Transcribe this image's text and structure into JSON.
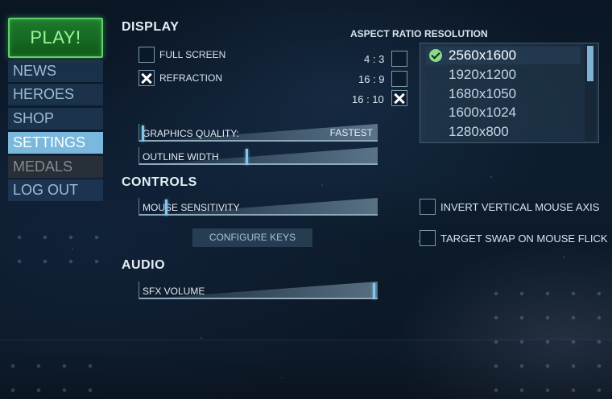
{
  "menu": {
    "play": "PLAY!",
    "items": [
      {
        "label": "NEWS"
      },
      {
        "label": "HEROES"
      },
      {
        "label": "SHOP"
      },
      {
        "label": "SETTINGS"
      },
      {
        "label": "MEDALS"
      },
      {
        "label": "LOG OUT"
      }
    ],
    "active": "SETTINGS"
  },
  "display": {
    "title": "DISPLAY",
    "full_screen": {
      "label": "FULL SCREEN",
      "checked": false
    },
    "refraction": {
      "label": "REFRACTION",
      "checked": true
    }
  },
  "aspect_ratio": {
    "title": "ASPECT RATIO",
    "options": [
      {
        "label": "4 : 3",
        "checked": false
      },
      {
        "label": "16 : 9",
        "checked": false
      },
      {
        "label": "16 : 10",
        "checked": true
      }
    ]
  },
  "resolution": {
    "title": "RESOLUTION",
    "options": [
      "2560x1600",
      "1920x1200",
      "1680x1050",
      "1600x1024",
      "1280x800"
    ],
    "selected": "2560x1600"
  },
  "sliders": {
    "graphics_quality": {
      "label": "GRAPHICS QUALITY:",
      "value_text": "FASTEST",
      "level": 0.01
    },
    "outline_width": {
      "label": "OUTLINE WIDTH",
      "level": 0.45
    },
    "mouse_sensitivity": {
      "label": "MOUSE SENSITIVITY",
      "level": 0.11
    },
    "sfx_volume": {
      "label": "SFX VOLUME",
      "level": 0.99
    }
  },
  "controls": {
    "title": "CONTROLS",
    "configure_keys": "CONFIGURE KEYS",
    "invert_mouse": {
      "label": "INVERT VERTICAL MOUSE AXIS",
      "checked": false
    },
    "target_swap": {
      "label": "TARGET SWAP ON MOUSE FLICK",
      "checked": false
    }
  },
  "audio": {
    "title": "AUDIO"
  }
}
